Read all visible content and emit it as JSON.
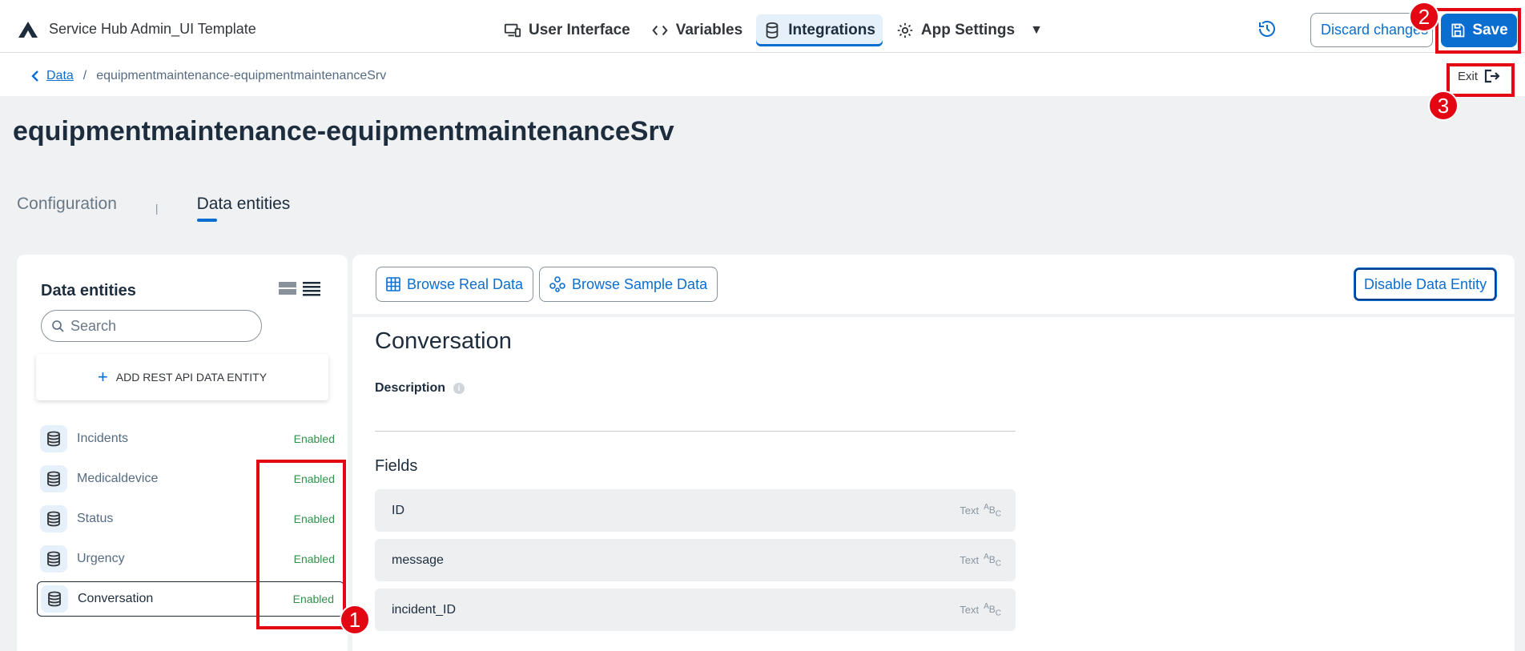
{
  "app": {
    "title": "Service Hub Admin_UI Template"
  },
  "nav": {
    "items": [
      {
        "label": "User Interface",
        "icon": "devices-icon"
      },
      {
        "label": "Variables",
        "icon": "code-icon"
      },
      {
        "label": "Integrations",
        "icon": "database-icon",
        "active": true
      },
      {
        "label": "App Settings",
        "icon": "gear-icon"
      }
    ]
  },
  "header": {
    "discard_label": "Discard changes",
    "save_label": "Save"
  },
  "breadcrumb": {
    "parent": "Data",
    "separator": "/",
    "current": "equipmentmaintenance-equipmentmaintenanceSrv"
  },
  "exit_label": "Exit",
  "page_title": "equipmentmaintenance-equipmentmaintenanceSrv",
  "tabs": [
    {
      "label": "Configuration",
      "active": false
    },
    {
      "label": "Data entities",
      "active": true
    }
  ],
  "tab_separator": "|",
  "sidebar": {
    "title": "Data entities",
    "search_placeholder": "Search",
    "add_label": "ADD REST API DATA ENTITY",
    "entities": [
      {
        "name": "Incidents",
        "status": "Enabled"
      },
      {
        "name": "Medicaldevice",
        "status": "Enabled"
      },
      {
        "name": "Status",
        "status": "Enabled"
      },
      {
        "name": "Urgency",
        "status": "Enabled"
      },
      {
        "name": "Conversation",
        "status": "Enabled",
        "selected": true
      }
    ]
  },
  "toolbar": {
    "browse_real": "Browse Real Data",
    "browse_sample": "Browse Sample Data",
    "disable": "Disable Data Entity"
  },
  "entity": {
    "title": "Conversation",
    "description_label": "Description",
    "fields_label": "Fields",
    "fields": [
      {
        "name": "ID",
        "type": "Text"
      },
      {
        "name": "message",
        "type": "Text"
      },
      {
        "name": "incident_ID",
        "type": "Text"
      }
    ]
  },
  "annotations": [
    "1",
    "2",
    "3"
  ],
  "colors": {
    "accent": "#0a6ed1",
    "enabled": "#30914c",
    "annotation": "#e30613"
  }
}
